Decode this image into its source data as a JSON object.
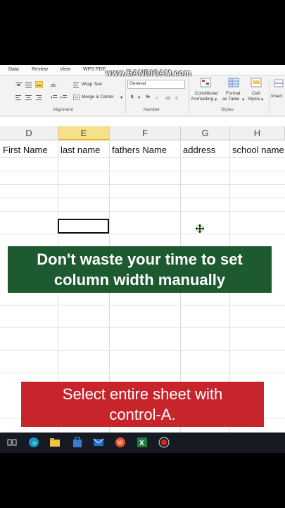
{
  "ribbon": {
    "tabs": [
      "Data",
      "Review",
      "View",
      "WPS PDF"
    ],
    "watermark": "www.BANDICAM.com",
    "wrap_text": "Wrap Text",
    "merge_center": "Merge & Center",
    "number_format": "General",
    "currency": "$",
    "percent": "%",
    "comma": ",",
    "conditional_formatting": [
      "Conditional",
      "Formatting"
    ],
    "format_as_table": [
      "Format",
      "as Table"
    ],
    "cell_styles": [
      "Cell",
      "Styles"
    ],
    "insert": "Insert",
    "group_alignment": "Alignment",
    "group_number": "Number",
    "group_styles": "Styles"
  },
  "sheet": {
    "columns": [
      "D",
      "E",
      "F",
      "G",
      "H"
    ],
    "selected_column": "E",
    "row1": [
      "First Name",
      "last name",
      "fathers Name",
      "address",
      "school name"
    ]
  },
  "captions": {
    "top": [
      "Don't waste your time to set",
      "column width manually"
    ],
    "bottom": [
      "Select entire sheet with",
      "control-A."
    ]
  },
  "colors": {
    "top_banner": "#1d5a30",
    "bottom_banner": "#c7242b",
    "selected_column_header": "#f7e08a"
  },
  "taskbar_icons": [
    "task-view-icon",
    "edge-icon",
    "file-explorer-icon",
    "store-icon",
    "mail-icon",
    "wps-icon",
    "excel-icon",
    "record-icon"
  ]
}
